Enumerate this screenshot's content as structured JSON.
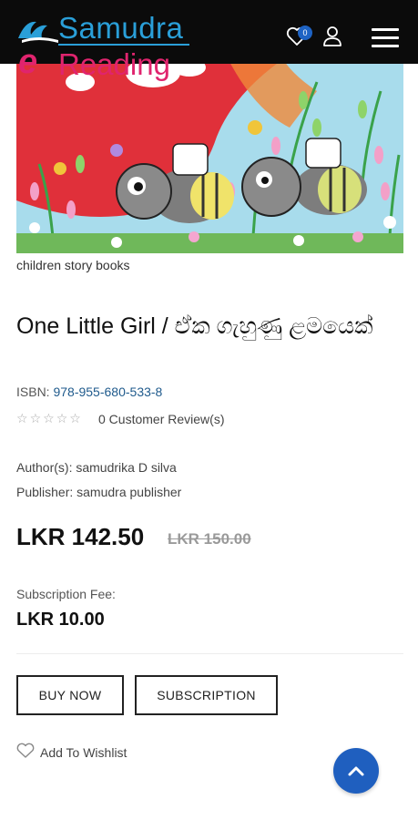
{
  "header": {
    "logo_line1": "Samudra",
    "logo_e": "e",
    "logo_line2": "Reading",
    "wishlist_count": "0",
    "icons": [
      "wishlist-heart-icon",
      "user-icon",
      "hamburger-menu-icon"
    ]
  },
  "product": {
    "category": "children story books",
    "title": "One Little Girl / ඒක ගැහුණු ළමයෙක්",
    "isbn_label": "ISBN:",
    "isbn": "978-955-680-533-8",
    "rating_stars": 0,
    "reviews": "0 Customer Review(s)",
    "author": "Author(s): samudrika D silva",
    "publisher": "Publisher: samudra publisher",
    "price": "LKR 142.50",
    "old_price": "LKR 150.00",
    "subscription_label": "Subscription Fee:",
    "subscription_fee": "LKR 10.00"
  },
  "actions": {
    "buy_now": "BUY NOW",
    "subscription": "SUBSCRIPTION",
    "add_to_wishlist": "Add To Wishlist"
  },
  "colors": {
    "header_bg": "#0b0b0b",
    "brand_blue": "#2a9fd8",
    "brand_pink": "#e0246e",
    "accent_blue": "#1f5fbf",
    "isbn_link": "#1f5a8c"
  }
}
